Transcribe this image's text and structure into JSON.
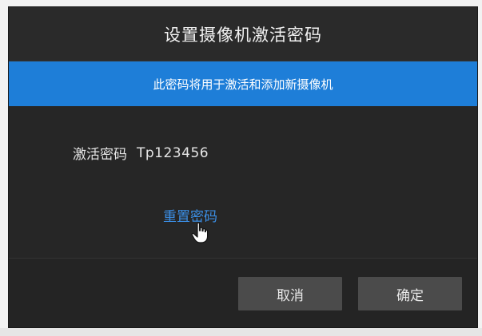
{
  "dialog": {
    "title": "设置摄像机激活密码",
    "banner": "此密码将用于激活和添加新摄像机",
    "password_label": "激活密码",
    "password_value": "Tp123456",
    "reset_link": "重置密码",
    "cancel_label": "取消",
    "ok_label": "确定"
  },
  "colors": {
    "accent": "#1e7ed8",
    "link": "#3b8fe6",
    "dialog_bg": "#282828",
    "button_bg": "#4b4b4b"
  },
  "icons": {
    "cursor": "hand-pointer-icon"
  }
}
